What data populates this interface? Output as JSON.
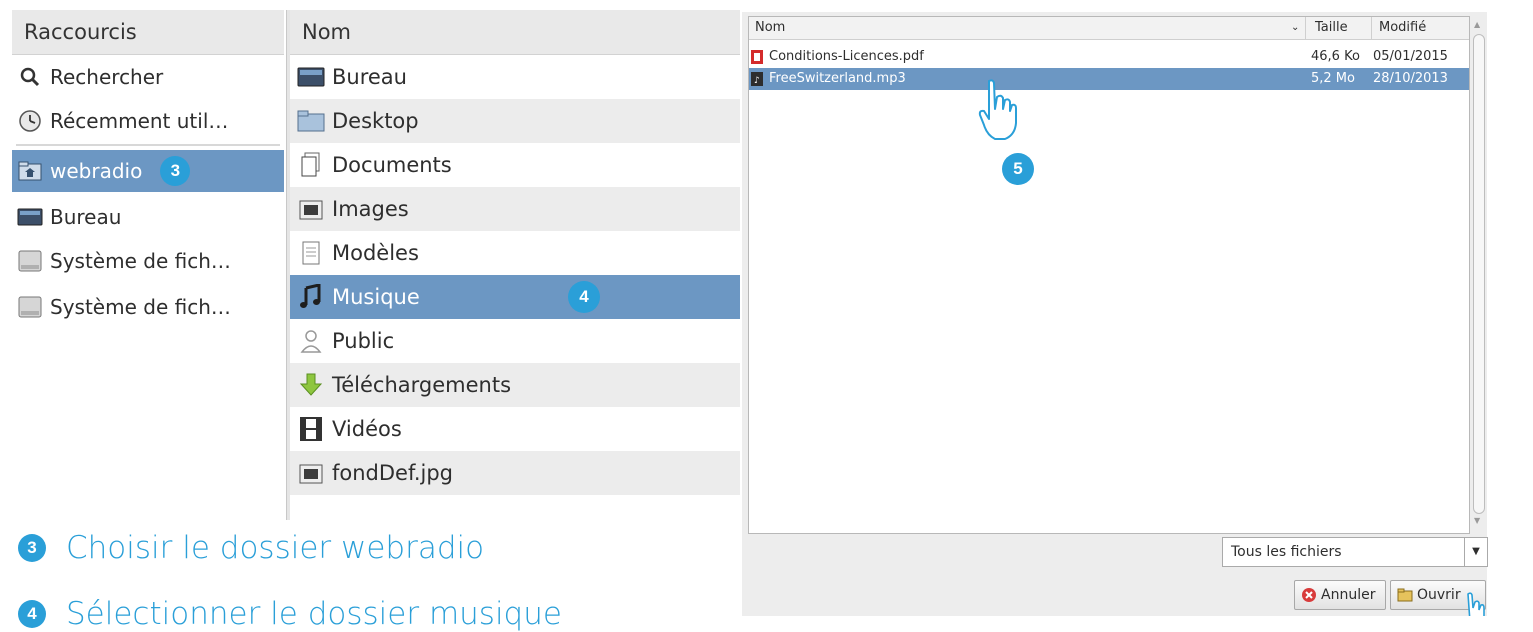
{
  "shortcuts": {
    "header": "Raccourcis",
    "items": [
      {
        "label": "Rechercher",
        "icon": "search-icon"
      },
      {
        "label": "Récemment util…",
        "icon": "recent-clock-icon"
      },
      {
        "label": "webradio",
        "icon": "home-folder-icon",
        "selected": true,
        "badge": "3"
      },
      {
        "label": "Bureau",
        "icon": "desktop-icon"
      },
      {
        "label": "Système de fich…",
        "icon": "drive-icon"
      },
      {
        "label": "Système de fich…",
        "icon": "drive-icon"
      }
    ]
  },
  "names": {
    "header": "Nom",
    "items": [
      {
        "label": "Bureau",
        "icon": "desktop-icon"
      },
      {
        "label": "Desktop",
        "icon": "folder-icon"
      },
      {
        "label": "Documents",
        "icon": "document-icon"
      },
      {
        "label": "Images",
        "icon": "image-icon"
      },
      {
        "label": "Modèles",
        "icon": "template-icon"
      },
      {
        "label": "Musique",
        "icon": "music-icon",
        "selected": true,
        "badge": "4"
      },
      {
        "label": "Public",
        "icon": "user-icon"
      },
      {
        "label": "Téléchargements",
        "icon": "download-arrow-icon"
      },
      {
        "label": "Vidéos",
        "icon": "film-icon"
      },
      {
        "label": "fondDef.jpg",
        "icon": "image-icon"
      }
    ]
  },
  "filelist": {
    "columns": {
      "name": "Nom",
      "size": "Taille",
      "modified": "Modifié"
    },
    "rows": [
      {
        "name": "Conditions-Licences.pdf",
        "size": "46,6 Ko",
        "modified": "05/01/2015",
        "icon": "pdf-icon"
      },
      {
        "name": "FreeSwitzerland.mp3",
        "size": "5,2 Mo",
        "modified": "28/10/2013",
        "icon": "audio-file-icon",
        "selected": true
      }
    ],
    "badge": "5"
  },
  "filter": {
    "label": "Tous les fichiers"
  },
  "buttons": {
    "cancel": "Annuler",
    "open": "Ouvrir"
  },
  "instructions": [
    {
      "number": "3",
      "text": "Choisir le dossier webradio"
    },
    {
      "number": "4",
      "text": "Sélectionner le dossier musique"
    }
  ],
  "colors": {
    "accent": "#2a9fd8",
    "selection": "#6c97c3"
  }
}
